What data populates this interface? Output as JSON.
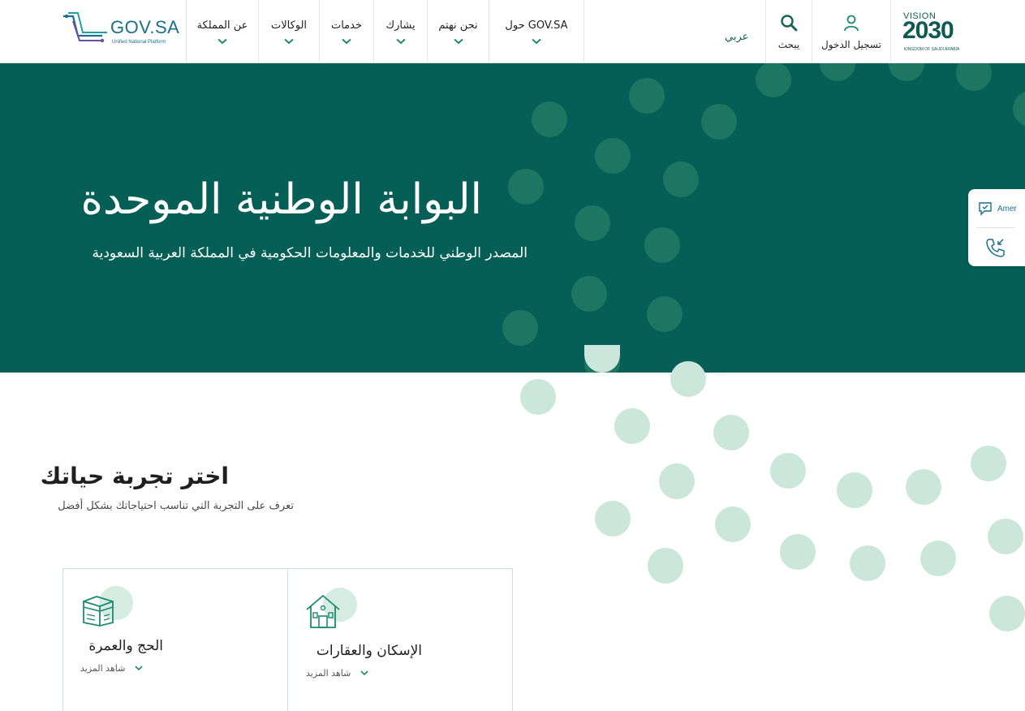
{
  "header": {
    "logo": {
      "text": "GOV.SA",
      "subtitle": "Unified National Platform"
    },
    "nav": [
      {
        "id": "about-kingdom",
        "label": "عن المملكة"
      },
      {
        "id": "agencies",
        "label": "الوكالات"
      },
      {
        "id": "services",
        "label": "خدمات"
      },
      {
        "id": "participate",
        "label": "يشارك"
      },
      {
        "id": "we-care",
        "label": "نحن نهتم"
      },
      {
        "id": "about-govsa",
        "label": "حول GOV.SA"
      }
    ],
    "language": "عربي",
    "search_label": "يبحث",
    "login_label": "تسجيل الدخول",
    "vision": {
      "top": "VISION",
      "number": "2030",
      "bottom": "KINGDOM OF SAUDI ARABIA"
    }
  },
  "hero": {
    "title": "البوابة الوطنية الموحدة",
    "subtitle": "المصدر الوطني للخدمات والمعلومات الحكومية في المملكة العربية السعودية"
  },
  "side_widget": {
    "chat_label": "Amer"
  },
  "life_section": {
    "title": "اختر تجربة حياتك",
    "subtitle": "تعرف على التجربة التي تناسب احتياجاتك بشكل أفضل",
    "cards": [
      {
        "id": "hajj",
        "title": "الحج والعمرة",
        "more": "شاهد المزيد",
        "icon": "kaaba-icon"
      },
      {
        "id": "housing",
        "title": "الإسكان والعقارات",
        "more": "شاهد المزيد",
        "icon": "house-icon"
      }
    ]
  },
  "colors": {
    "brand_green": "#065f56",
    "dot_dark": "#1e7561",
    "dot_light": "#cbe6da",
    "link_blue": "#1a6f8a"
  }
}
